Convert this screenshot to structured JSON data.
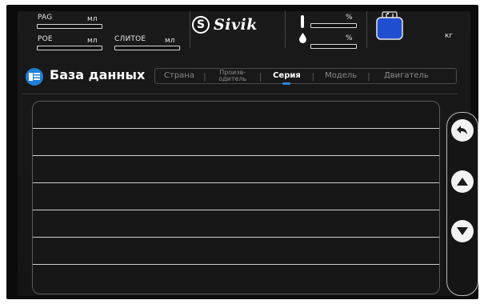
{
  "status": {
    "pag_label": "PAG",
    "pag_unit": "мл",
    "poe_label": "POE",
    "poe_unit": "мл",
    "drain_label": "СЛИТОЕ",
    "drain_unit": "мл",
    "temp_unit": "%",
    "humidity_unit": "%",
    "weight_unit": "кг"
  },
  "brand": {
    "name": "Sivik",
    "mark": "S"
  },
  "header": {
    "title": "База данных",
    "icon": "database-icon"
  },
  "tabs": [
    {
      "label": "Страна",
      "active": false
    },
    {
      "label_line1": "Произв-",
      "label_line2": "одитель",
      "active": false
    },
    {
      "label": "Серия",
      "active": true
    },
    {
      "label": "Модель",
      "active": false
    },
    {
      "label": "Двигатель",
      "active": false
    }
  ],
  "list": {
    "rows": [
      "",
      "",
      "",
      "",
      "",
      "",
      ""
    ]
  },
  "side_buttons": {
    "back": "back-icon",
    "up": "arrow-up-icon",
    "down": "arrow-down-icon"
  },
  "colors": {
    "accent": "#2b86e0",
    "tank": "#1f4fd0",
    "background": "#141414"
  }
}
